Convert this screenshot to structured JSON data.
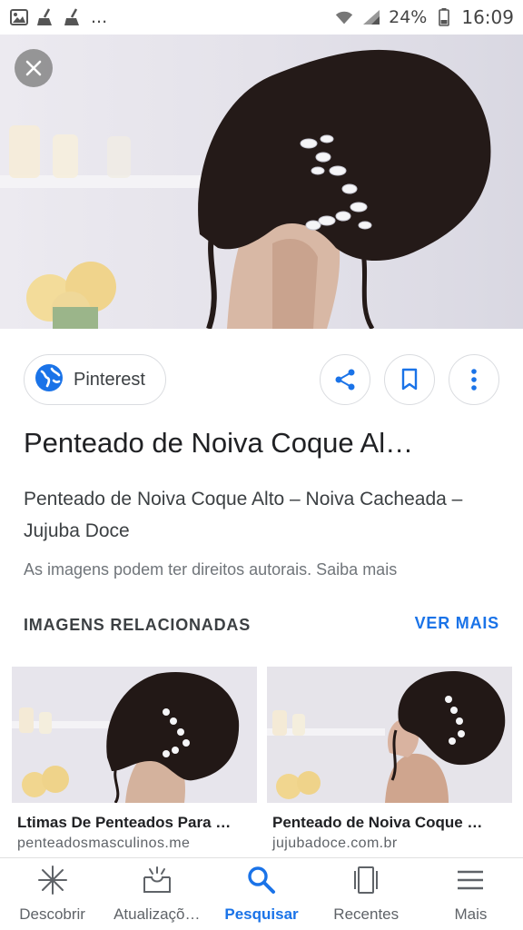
{
  "status_bar": {
    "left_icons": [
      "image-icon",
      "broom-icon",
      "broom-icon"
    ],
    "ellipsis": "...",
    "battery": "24%",
    "time": "16:09"
  },
  "source": {
    "name": "Pinterest"
  },
  "result": {
    "title": "Penteado de Noiva Coque Al…",
    "subtitle": "Penteado de Noiva Coque Alto – Noiva Cacheada – Jujuba Doce",
    "rights_notice": "As imagens podem ter direitos autorais. Saiba mais"
  },
  "related": {
    "heading": "IMAGENS RELACIONADAS",
    "see_more": "VER MAIS",
    "items": [
      {
        "title": "Ltimas De Penteados Para …",
        "domain": "penteadosmasculinos.me"
      },
      {
        "title": "Penteado de Noiva Coque …",
        "domain": "jujubadoce.com.br"
      }
    ]
  },
  "bottom_nav": {
    "items": [
      {
        "label": "Descobrir",
        "icon": "asterisk-icon"
      },
      {
        "label": "Atualizaçõ…",
        "icon": "inbox-icon"
      },
      {
        "label": "Pesquisar",
        "icon": "search-icon",
        "active": true
      },
      {
        "label": "Recentes",
        "icon": "recent-cards-icon"
      },
      {
        "label": "Mais",
        "icon": "menu-icon"
      }
    ]
  },
  "colors": {
    "accent": "#1a73e8",
    "text": "#202124",
    "muted": "#70757a"
  }
}
